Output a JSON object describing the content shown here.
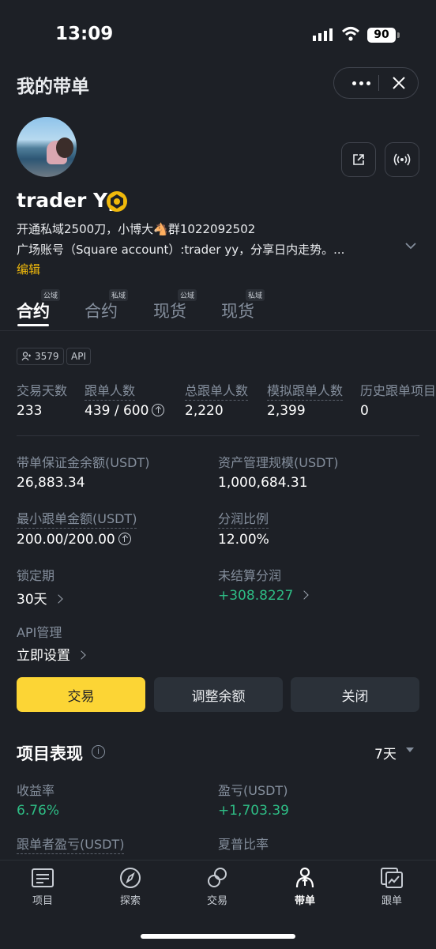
{
  "status": {
    "time": "13:09",
    "battery": "90"
  },
  "header": {
    "title": "我的带单"
  },
  "profile": {
    "name": "trader Yy",
    "bio_line1": "开通私域2500刀，小博大🐴群1022092502",
    "bio_line2": "广场账号（Square account）:trader yy，分享日内走势。...",
    "edit_label": "编辑"
  },
  "tabs": [
    {
      "label": "合约",
      "tag": "公域"
    },
    {
      "label": "合约",
      "tag": "私域"
    },
    {
      "label": "现货",
      "tag": "公域"
    },
    {
      "label": "现货",
      "tag": "私域"
    }
  ],
  "chips": {
    "followers": "3579",
    "api": "API"
  },
  "stats": [
    {
      "label": "交易天数",
      "value": "233"
    },
    {
      "label": "跟单人数",
      "value": "439 / 600"
    },
    {
      "label": "总跟单人数",
      "value": "2,220"
    },
    {
      "label": "模拟跟单人数",
      "value": "2,399"
    },
    {
      "label": "历史跟单项目",
      "value": "0"
    }
  ],
  "details": {
    "margin_balance_label": "带单保证金余额(USDT)",
    "margin_balance_value": "26,883.34",
    "aum_label": "资产管理规模(USDT)",
    "aum_value": "1,000,684.31",
    "min_copy_label": "最小跟单金额(USDT)",
    "min_copy_value": "200.00/200.00",
    "profit_share_label": "分润比例",
    "profit_share_value": "12.00%",
    "lock_label": "锁定期",
    "lock_value": "30天",
    "unsettled_label": "未结算分润",
    "unsettled_value": "+308.8227",
    "api_label": "API管理",
    "api_value": "立即设置"
  },
  "actions": {
    "trade": "交易",
    "adjust": "调整余额",
    "close": "关闭"
  },
  "performance": {
    "title": "项目表现",
    "period": "7天",
    "roi_label": "收益率",
    "roi_value": "6.76%",
    "pnl_label": "盈亏(USDT)",
    "pnl_value": "+1,703.39",
    "follower_pnl_label": "跟单者盈亏(USDT)",
    "sharpe_label": "夏普比率"
  },
  "nav": [
    {
      "label": "项目",
      "icon": "list-icon"
    },
    {
      "label": "探索",
      "icon": "compass-icon"
    },
    {
      "label": "交易",
      "icon": "trade-icon"
    },
    {
      "label": "带单",
      "icon": "person-icon"
    },
    {
      "label": "跟单",
      "icon": "chart-icon"
    }
  ],
  "colors": {
    "accent": "#fcd535",
    "positive": "#2ebd85",
    "background": "#1d2026",
    "link": "#f0b90b"
  }
}
